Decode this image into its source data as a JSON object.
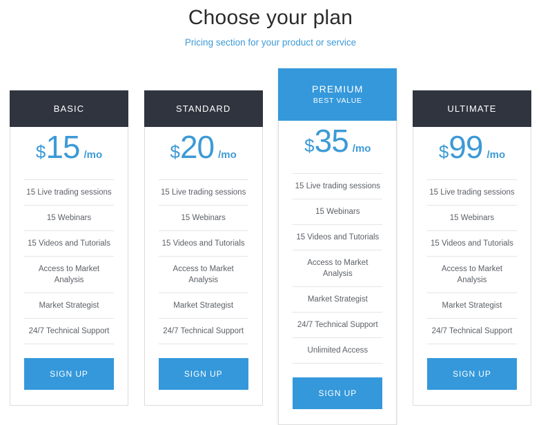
{
  "heading": {
    "title": "Choose your plan",
    "subtitle": "Pricing section for your product or service"
  },
  "colors": {
    "accent_blue": "#3498db",
    "header_dark": "#30343f",
    "price_blue": "#3d9ad6",
    "feature_text": "#5b5f66",
    "separator": "#e4e4e4",
    "card_border": "#dcdcdc"
  },
  "currency_symbol": "$",
  "period_label": "/mo",
  "cta_label": "SIGN UP",
  "plans": [
    {
      "name": "BASIC",
      "tagline": "",
      "featured": false,
      "currency": "$",
      "amount": "15",
      "period": "/mo",
      "features": [
        "15 Live trading sessions",
        "15 Webinars",
        "15 Videos and Tutorials",
        "Access to Market Analysis",
        "Market Strategist",
        "24/7 Technical Support"
      ],
      "cta": "SIGN UP"
    },
    {
      "name": "STANDARD",
      "tagline": "",
      "featured": false,
      "currency": "$",
      "amount": "20",
      "period": "/mo",
      "features": [
        "15 Live trading sessions",
        "15 Webinars",
        "15 Videos and Tutorials",
        "Access to Market Analysis",
        "Market Strategist",
        "24/7 Technical Support"
      ],
      "cta": "SIGN UP"
    },
    {
      "name": "PREMIUM",
      "tagline": "BEST VALUE",
      "featured": true,
      "currency": "$",
      "amount": "35",
      "period": "/mo",
      "features": [
        "15 Live trading sessions",
        "15 Webinars",
        "15 Videos and Tutorials",
        "Access to Market Analysis",
        "Market Strategist",
        "24/7 Technical Support",
        "Unlimited Access"
      ],
      "cta": "SIGN UP"
    },
    {
      "name": "ULTIMATE",
      "tagline": "",
      "featured": false,
      "currency": "$",
      "amount": "99",
      "period": "/mo",
      "features": [
        "15 Live trading sessions",
        "15 Webinars",
        "15 Videos and Tutorials",
        "Access to Market Analysis",
        "Market Strategist",
        "24/7 Technical Support"
      ],
      "cta": "SIGN UP"
    }
  ]
}
